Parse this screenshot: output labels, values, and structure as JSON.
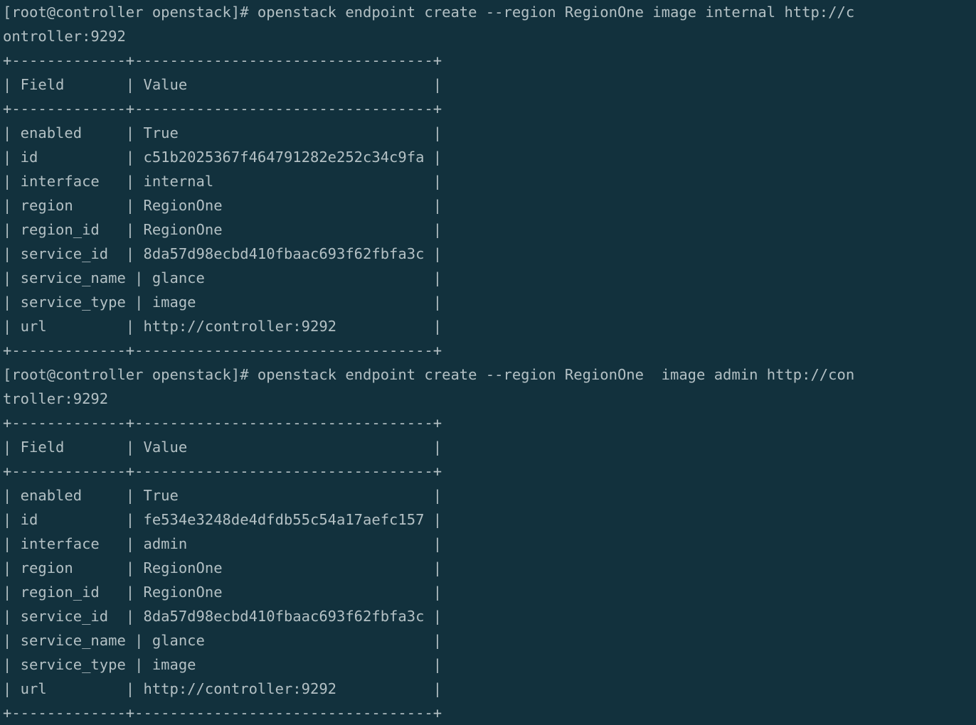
{
  "terminal": {
    "app": "terminal-emulator",
    "colors": {
      "background": "#12313d",
      "foreground": "#b3c0c4"
    },
    "prompt": "[root@controller openstack]#",
    "commands": [
      {
        "text": "openstack endpoint create --region RegionOne image internal http://controller:9292",
        "result_table": {
          "headers": [
            "Field",
            "Value"
          ],
          "rows": [
            [
              "enabled",
              "True"
            ],
            [
              "id",
              "c51b2025367f464791282e252c34c9fa"
            ],
            [
              "interface",
              "internal"
            ],
            [
              "region",
              "RegionOne"
            ],
            [
              "region_id",
              "RegionOne"
            ],
            [
              "service_id",
              "8da57d98ecbd410fbaac693f62fbfa3c"
            ],
            [
              "service_name",
              "glance"
            ],
            [
              "service_type",
              "image"
            ],
            [
              "url",
              "http://controller:9292"
            ]
          ]
        }
      },
      {
        "text": "openstack endpoint create --region RegionOne  image admin http://controller:9292",
        "result_table": {
          "headers": [
            "Field",
            "Value"
          ],
          "rows": [
            [
              "enabled",
              "True"
            ],
            [
              "id",
              "fe534e3248de4dfdb55c54a17aefc157"
            ],
            [
              "interface",
              "admin"
            ],
            [
              "region",
              "RegionOne"
            ],
            [
              "region_id",
              "RegionOne"
            ],
            [
              "service_id",
              "8da57d98ecbd410fbaac693f62fbfa3c"
            ],
            [
              "service_name",
              "glance"
            ],
            [
              "service_type",
              "image"
            ],
            [
              "url",
              "http://controller:9292"
            ]
          ]
        }
      }
    ],
    "lines": [
      "[root@controller openstack]# openstack endpoint create --region RegionOne image internal http://c",
      "ontroller:9292",
      "+-------------+----------------------------------+",
      "| Field       | Value                            |",
      "+-------------+----------------------------------+",
      "| enabled     | True                             |",
      "| id          | c51b2025367f464791282e252c34c9fa |",
      "| interface   | internal                         |",
      "| region      | RegionOne                        |",
      "| region_id   | RegionOne                        |",
      "| service_id  | 8da57d98ecbd410fbaac693f62fbfa3c |",
      "| service_name | glance                          |",
      "| service_type | image                           |",
      "| url         | http://controller:9292           |",
      "+-------------+----------------------------------+",
      "[root@controller openstack]# openstack endpoint create --region RegionOne  image admin http://con",
      "troller:9292",
      "+-------------+----------------------------------+",
      "| Field       | Value                            |",
      "+-------------+----------------------------------+",
      "| enabled     | True                             |",
      "| id          | fe534e3248de4dfdb55c54a17aefc157 |",
      "| interface   | admin                            |",
      "| region      | RegionOne                        |",
      "| region_id   | RegionOne                        |",
      "| service_id  | 8da57d98ecbd410fbaac693f62fbfa3c |",
      "| service_name | glance                          |",
      "| service_type | image                           |",
      "| url         | http://controller:9292           |",
      "+-------------+----------------------------------+"
    ]
  }
}
